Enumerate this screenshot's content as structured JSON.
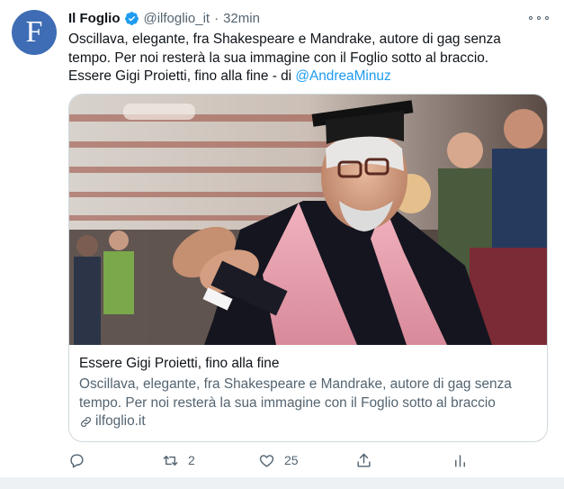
{
  "tweet": {
    "author_initial": "F",
    "author_name": "Il Foglio",
    "handle": "@ilfoglio_it",
    "separator": "·",
    "time": "32min",
    "text_lines": [
      "Oscillava, elegante, fra Shakespeare e Mandrake, autore di gag senza",
      "tempo. Per noi resterà la sua immagine con il Foglio sotto al braccio."
    ],
    "text_line3_prefix": "Essere Gigi Proietti, fino alla fine - di ",
    "mention": "@AndreaMinuz",
    "accent_color": "#1d9bf0"
  },
  "card": {
    "title": "Essere Gigi Proietti, fino alla fine",
    "description_lines": [
      "Oscillava, elegante, fra Shakespeare e Mandrake, autore di gag senza",
      "tempo. Per noi resterà la sua immagine con il Foglio sotto al braccio"
    ],
    "domain": "ilfoglio.it",
    "image_icon": "photo-elderly-man-in-graduation-cap-applauding"
  },
  "actions": {
    "reply": {
      "icon": "reply-icon",
      "count": ""
    },
    "retweet": {
      "icon": "retweet-icon",
      "count": "2"
    },
    "like": {
      "icon": "heart-icon",
      "count": "25"
    },
    "share": {
      "icon": "share-icon",
      "count": ""
    },
    "analytics": {
      "icon": "analytics-icon",
      "count": ""
    }
  }
}
